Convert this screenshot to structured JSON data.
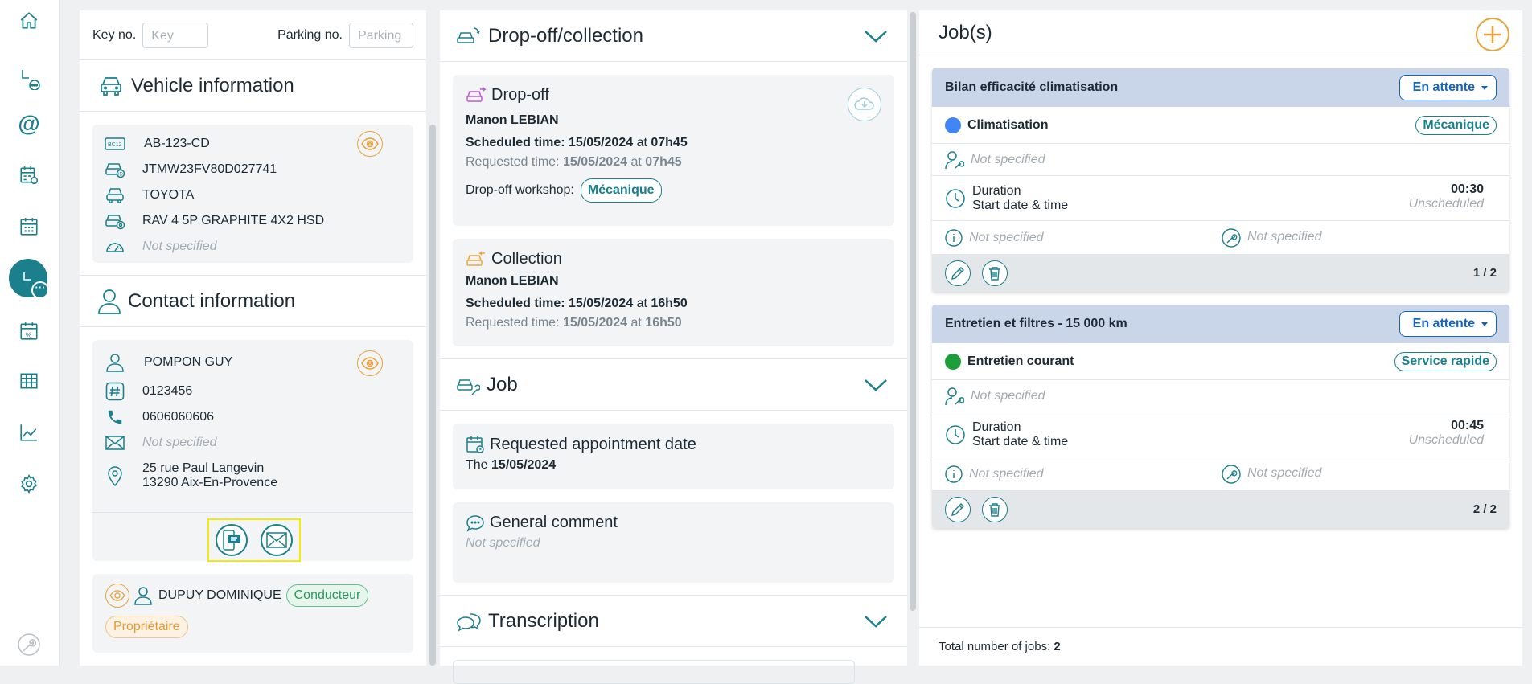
{
  "header": {
    "key_label": "Key no.",
    "key_placeholder": "Key",
    "parking_label": "Parking no.",
    "parking_placeholder": "Parking"
  },
  "vehicle": {
    "title": "Vehicle information",
    "plate": "AB-123-CD",
    "vin": "JTMW23FV80D027741",
    "brand": "TOYOTA",
    "model": "RAV 4 5P GRAPHITE 4X2 HSD",
    "mileage": "Not specified"
  },
  "contact": {
    "title": "Contact information",
    "name": "POMPON GUY",
    "account": "0123456",
    "phone": "0606060606",
    "email": "Not specified",
    "address_line1": "25 rue Paul Langevin",
    "address_line2": "13290 Aix-En-Provence",
    "driver_name": "DUPUY DOMINIQUE",
    "driver_badge": "Conducteur",
    "owner_badge": "Propriétaire"
  },
  "dropoff_section": {
    "title": "Drop-off/collection",
    "dropoff": {
      "title": "Drop-off",
      "name": "Manon LEBIAN",
      "scheduled_label": "Scheduled time:",
      "scheduled_date": "15/05/2024",
      "at": "at",
      "scheduled_time": "07h45",
      "requested_label": "Requested time:",
      "requested_date": "15/05/2024",
      "requested_time": "07h45",
      "workshop_label": "Drop-off workshop:",
      "workshop": "Mécanique"
    },
    "collection": {
      "title": "Collection",
      "name": "Manon LEBIAN",
      "scheduled_label": "Scheduled time:",
      "scheduled_date": "15/05/2024",
      "scheduled_time": "16h50",
      "requested_label": "Requested time:",
      "requested_date": "15/05/2024",
      "requested_time": "16h50"
    }
  },
  "job_section": {
    "title": "Job",
    "appointment_title": "Requested appointment date",
    "appointment_prefix": "The",
    "appointment_date": "15/05/2024",
    "comment_title": "General comment",
    "comment": "Not specified"
  },
  "transcription": {
    "title": "Transcription"
  },
  "jobs": {
    "title": "Job(s)",
    "total_label": "Total number of jobs:",
    "total": "2",
    "items": [
      {
        "title": "Bilan efficacité climatisation",
        "status": "En attente",
        "category": "Climatisation",
        "category_color": "#4285f4",
        "workshop": "Mécanique",
        "technician": "Not specified",
        "duration_label": "Duration",
        "duration": "00:30",
        "start_label": "Start date & time",
        "start": "Unscheduled",
        "info": "Not specified",
        "tool": "Not specified",
        "index": "1 / 2"
      },
      {
        "title": "Entretien et filtres - 15 000 km",
        "status": "En attente",
        "category": "Entretien courant",
        "category_color": "#1e9e3a",
        "workshop": "Service rapide",
        "technician": "Not specified",
        "duration_label": "Duration",
        "duration": "00:45",
        "start_label": "Start date & time",
        "start": "Unscheduled",
        "info": "Not specified",
        "tool": "Not specified",
        "index": "2 / 2"
      }
    ]
  }
}
